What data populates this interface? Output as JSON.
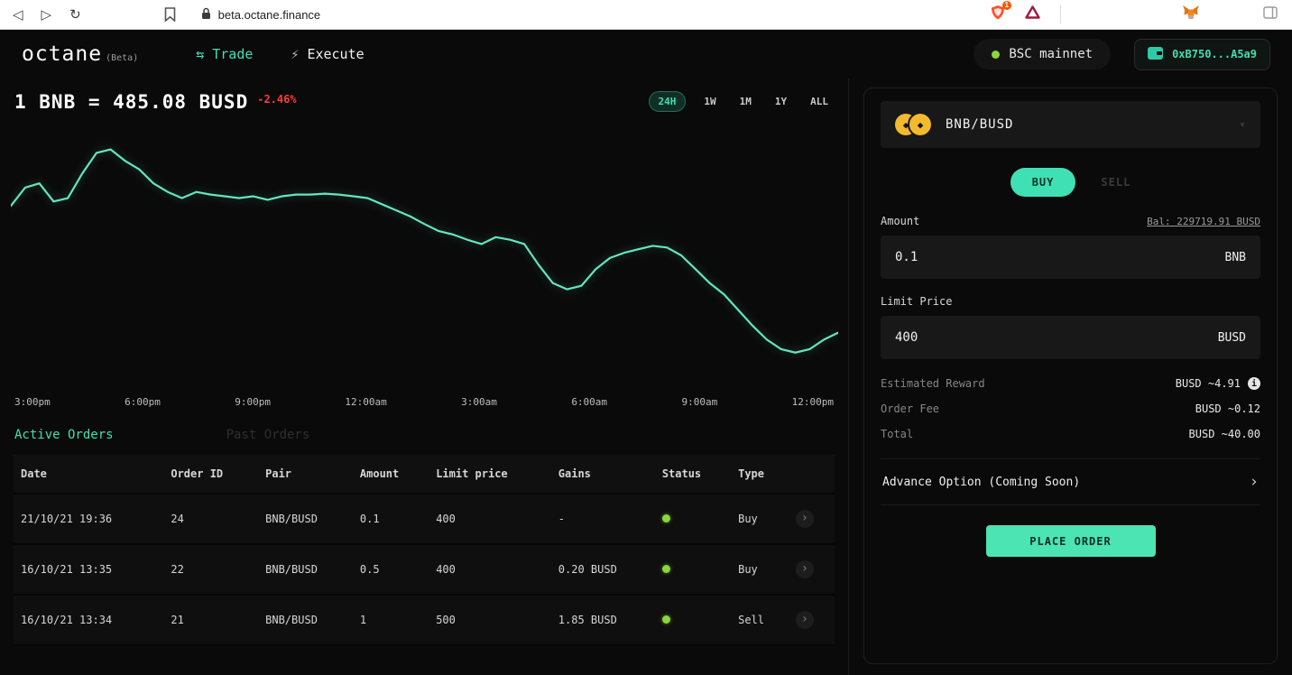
{
  "browser": {
    "url": "beta.octane.finance",
    "shield_badge": "1"
  },
  "header": {
    "logo": "octane",
    "beta": "(Beta)",
    "nav": [
      {
        "label": "Trade",
        "active": true
      },
      {
        "label": "Execute",
        "active": false
      }
    ],
    "network": "BSC mainnet",
    "wallet": "0xB750...A5a9"
  },
  "price_header": {
    "pair_line": "1 BNB = 485.08 BUSD",
    "change": "-2.46%",
    "ranges": [
      "24H",
      "1W",
      "1M",
      "1Y",
      "ALL"
    ],
    "active_range": "24H"
  },
  "chart_data": {
    "type": "line",
    "title": "BNB/BUSD 24H price",
    "x_labels": [
      "3:00pm",
      "6:00pm",
      "9:00pm",
      "12:00am",
      "3:00am",
      "6:00am",
      "9:00am",
      "12:00pm"
    ],
    "values": [
      498.2,
      500.3,
      500.8,
      498.7,
      499.1,
      501.9,
      504.3,
      504.7,
      503.4,
      502.4,
      500.8,
      499.8,
      499.1,
      499.8,
      499.5,
      499.3,
      499.1,
      499.3,
      498.9,
      499.3,
      499.5,
      499.5,
      499.6,
      499.5,
      499.3,
      499.1,
      498.4,
      497.7,
      497.0,
      496.1,
      495.3,
      494.9,
      494.3,
      493.8,
      494.6,
      494.3,
      493.8,
      491.4,
      489.3,
      488.6,
      489.0,
      490.9,
      492.2,
      492.8,
      493.2,
      493.6,
      493.4,
      492.5,
      490.9,
      489.3,
      488.0,
      486.2,
      484.4,
      482.8,
      481.7,
      481.3,
      481.7,
      482.8,
      483.6
    ],
    "ylim": [
      478,
      507
    ],
    "color": "#63e6be",
    "grid": false,
    "legend": "none"
  },
  "orders": {
    "tabs": [
      "Active Orders",
      "Past Orders"
    ],
    "active_tab": "Active Orders",
    "headers": [
      "Date",
      "Order ID",
      "Pair",
      "Amount",
      "Limit price",
      "Gains",
      "Status",
      "Type"
    ],
    "rows": [
      {
        "date": "21/10/21 19:36",
        "order_id": "24",
        "pair": "BNB/BUSD",
        "amount": "0.1",
        "limit_price": "400",
        "gains": "-",
        "status": "active",
        "type": "Buy"
      },
      {
        "date": "16/10/21 13:35",
        "order_id": "22",
        "pair": "BNB/BUSD",
        "amount": "0.5",
        "limit_price": "400",
        "gains": "0.20 BUSD",
        "status": "active",
        "type": "Buy"
      },
      {
        "date": "16/10/21 13:34",
        "order_id": "21",
        "pair": "BNB/BUSD",
        "amount": "1",
        "limit_price": "500",
        "gains": "1.85 BUSD",
        "status": "active",
        "type": "Sell"
      }
    ]
  },
  "trade_panel": {
    "pair": "BNB/BUSD",
    "side_buy": "BUY",
    "side_sell": "SELL",
    "amount_label": "Amount",
    "balance": "Bal: 229719.91 BUSD",
    "amount_value": "0.1",
    "amount_unit": "BNB",
    "limit_label": "Limit Price",
    "limit_value": "400",
    "limit_unit": "BUSD",
    "summary": [
      {
        "label": "Estimated Reward",
        "value": "BUSD ~4.91",
        "info": true
      },
      {
        "label": "Order Fee",
        "value": "BUSD ~0.12"
      },
      {
        "label": "Total",
        "value": "BUSD ~40.00"
      }
    ],
    "advance_option": "Advance Option (Coming Soon)",
    "place_order": "PLACE ORDER"
  }
}
